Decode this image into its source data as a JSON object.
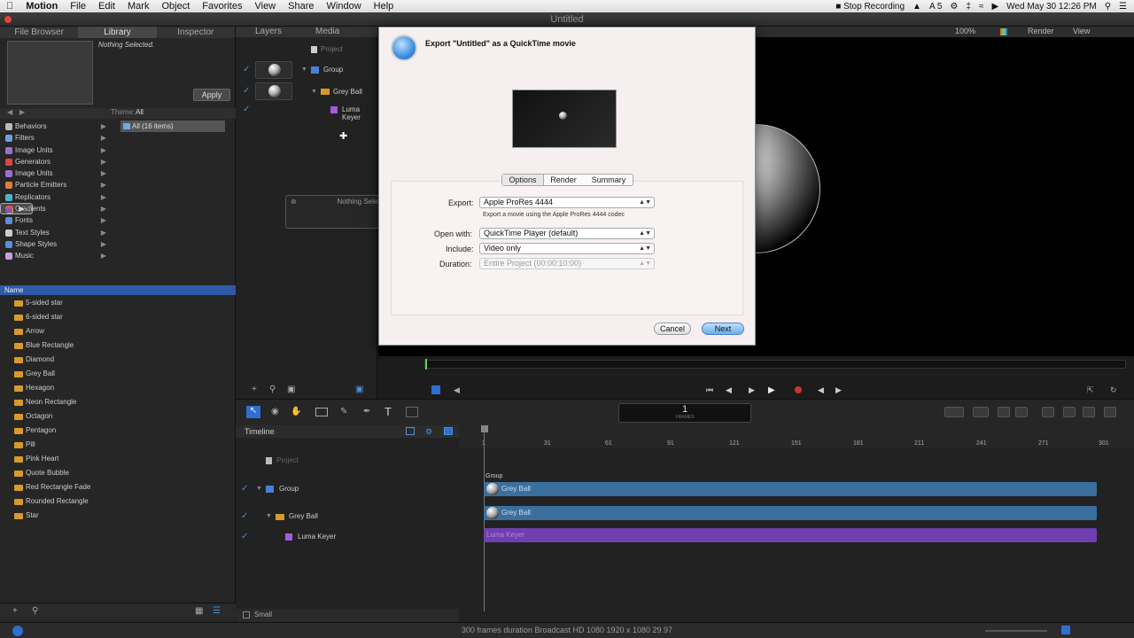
{
  "menubar": {
    "app": "Motion",
    "items": [
      "File",
      "Edit",
      "Mark",
      "Object",
      "Favorites",
      "View",
      "Share",
      "Window",
      "Help"
    ],
    "stop_recording": "Stop Recording",
    "battery": "5",
    "clock": "Wed May 30  12:26 PM"
  },
  "window": {
    "title": "Untitled"
  },
  "left": {
    "tabs": [
      "File Browser",
      "Library",
      "Inspector"
    ],
    "nothing_selected": "Nothing Selected.",
    "apply": "Apply",
    "theme_label": "Theme:",
    "theme_value": "All",
    "all_items": "All (16 items)",
    "categories": [
      "Behaviors",
      "Filters",
      "Image Units",
      "Generators",
      "Image Units",
      "Particle Emitters",
      "Replicators",
      "Shapes",
      "Gradients",
      "Fonts",
      "Text Styles",
      "Shape Styles",
      "Music"
    ],
    "name_header": "Name",
    "items": [
      "5-sided star",
      "6-sided star",
      "Arrow",
      "Blue Rectangle",
      "Diamond",
      "Grey Ball",
      "Hexagon",
      "Neon Rectangle",
      "Octagon",
      "Pentagon",
      "Pill",
      "Pink Heart",
      "Quote Bubble",
      "Red Rectangle Fade",
      "Rounded Rectangle",
      "Star"
    ]
  },
  "layers": {
    "tabs": [
      "Layers",
      "Media"
    ],
    "project": "Project",
    "group": "Group",
    "grey_ball": "Grey Ball",
    "luma_keyer": "Luma Keyer"
  },
  "viewer": {
    "zoom": "100%",
    "render": "Render",
    "view": "View"
  },
  "hud": {
    "title": "Nothing Selected"
  },
  "dialog": {
    "title": "Export \"Untitled\" as a QuickTime movie",
    "tabs": [
      "Options",
      "Render",
      "Summary"
    ],
    "export_label": "Export:",
    "export_value": "Apple ProRes 4444",
    "export_desc": "Export a movie using the Apple ProRes 4444 codec",
    "open_label": "Open with:",
    "open_value": "QuickTime Player (default)",
    "include_label": "Include:",
    "include_value": "Video only",
    "duration_label": "Duration:",
    "duration_value": "Entire Project (00:00:10:00)",
    "cancel": "Cancel",
    "next": "Next"
  },
  "transport": {
    "frame": "1",
    "frames_label": "FRAMES"
  },
  "timeline": {
    "title": "Timeline",
    "project": "Project",
    "group": "Group",
    "grey_ball": "Grey Ball",
    "luma_keyer": "Luma Keyer",
    "ruler": [
      "1",
      "31",
      "61",
      "91",
      "121",
      "151",
      "181",
      "211",
      "241",
      "271",
      "301"
    ],
    "size": "Small"
  },
  "status": "300 frames duration Broadcast HD 1080 1920 x 1080 29.97"
}
